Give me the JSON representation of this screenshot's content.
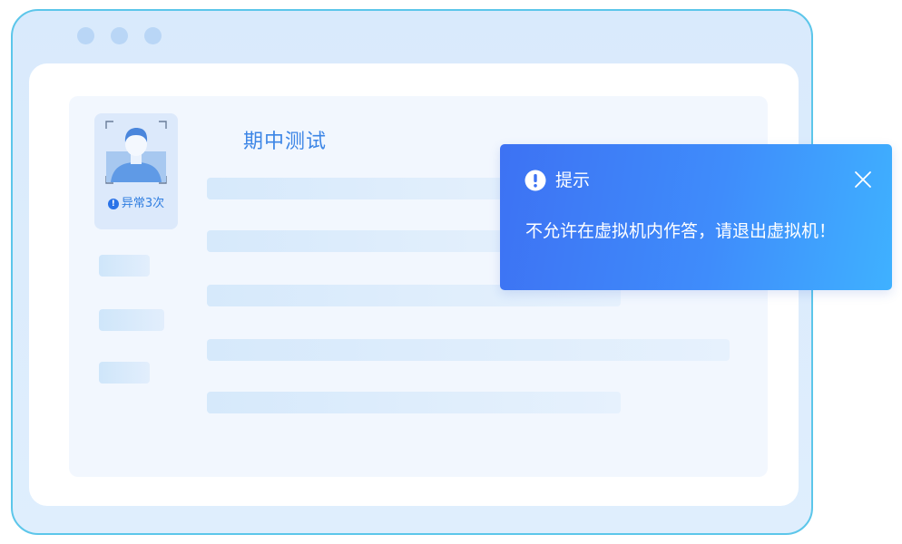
{
  "exam": {
    "title": "期中测试"
  },
  "proctor": {
    "warning_text": "异常3次",
    "warning_icon": "exclamation-circle-icon",
    "avatar_icon": "user-avatar-icon"
  },
  "dialog": {
    "title": "提示",
    "message": "不允许在虚拟机内作答，请退出虚拟机！",
    "icon": "exclamation-circle-icon",
    "close_icon": "close-icon"
  },
  "colors": {
    "accent": "#3d86e6",
    "dialog_gradient_start": "#3d72f3",
    "dialog_gradient_end": "#3fb1ff",
    "window_border": "#5cc6ea"
  }
}
